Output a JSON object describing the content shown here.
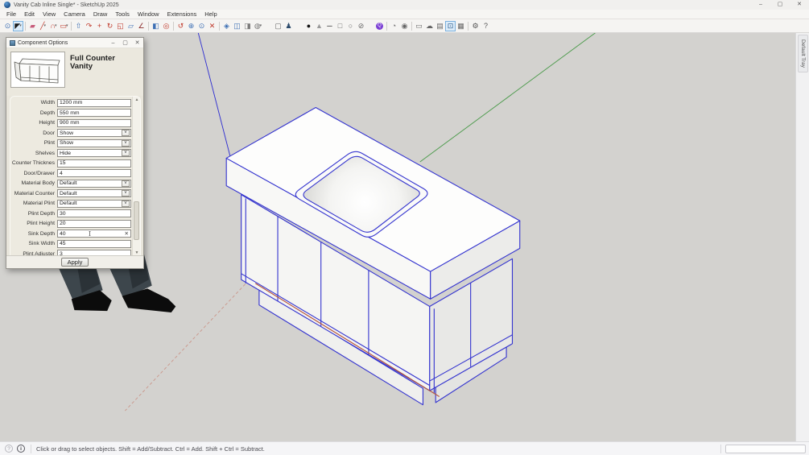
{
  "window": {
    "title": "Vanity Cab Inline Single* - SketchUp 2025"
  },
  "menu": {
    "items": [
      "File",
      "Edit",
      "View",
      "Camera",
      "Draw",
      "Tools",
      "Window",
      "Extensions",
      "Help"
    ]
  },
  "toolbar": {
    "items": [
      {
        "name": "search",
        "glyph": "⊙",
        "color": "#3d6fb4"
      },
      {
        "name": "select",
        "glyph": "◤",
        "color": "#1a1a1a",
        "active": true,
        "dd": true
      },
      {
        "sep": true
      },
      {
        "name": "eraser",
        "glyph": "▰",
        "color": "#c75b7a"
      },
      {
        "name": "line",
        "glyph": "╱",
        "color": "#c0392b",
        "dd": true
      },
      {
        "name": "arc",
        "glyph": "∩",
        "color": "#c0392b",
        "dd": true
      },
      {
        "name": "rectangle",
        "glyph": "▭",
        "color": "#c0392b",
        "dd": true
      },
      {
        "sep": true
      },
      {
        "name": "push-pull",
        "glyph": "⇧",
        "color": "#3d6fb4"
      },
      {
        "name": "follow-me",
        "glyph": "↷",
        "color": "#c0392b"
      },
      {
        "name": "move",
        "glyph": "+",
        "color": "#c0392b"
      },
      {
        "name": "rotate",
        "glyph": "↻",
        "color": "#c0392b"
      },
      {
        "name": "scale",
        "glyph": "◱",
        "color": "#c0392b"
      },
      {
        "name": "tape-measure",
        "glyph": "▱",
        "color": "#3d6fb4"
      },
      {
        "name": "axes",
        "glyph": "∠",
        "color": "#8a2a2a"
      },
      {
        "sep": true
      },
      {
        "name": "paint-bucket",
        "glyph": "◧",
        "color": "#3d6fb4"
      },
      {
        "name": "offset",
        "glyph": "◎",
        "color": "#c0392b"
      },
      {
        "sep": true
      },
      {
        "name": "orbit",
        "glyph": "↺",
        "color": "#c0392b"
      },
      {
        "name": "pan",
        "glyph": "⊕",
        "color": "#3d6fb4"
      },
      {
        "name": "zoom",
        "glyph": "⊙",
        "color": "#3d6fb4"
      },
      {
        "name": "zoom-extents",
        "glyph": "✕",
        "color": "#c0392b"
      },
      {
        "sep": true
      },
      {
        "name": "make-component",
        "glyph": "◈",
        "color": "#3d6fb4"
      },
      {
        "name": "component-browser",
        "glyph": "◫",
        "color": "#3d6fb4"
      },
      {
        "name": "share-model",
        "glyph": "◨",
        "color": "#7a7a7a"
      },
      {
        "name": "face-style",
        "glyph": "◍",
        "color": "#7a7a7a",
        "dd": true
      },
      {
        "gap": 12
      },
      {
        "name": "new-document",
        "glyph": "▢",
        "color": "#666666"
      },
      {
        "name": "add-person",
        "glyph": "♟",
        "color": "#2b4a6b"
      },
      {
        "gap": 12
      },
      {
        "name": "style-point",
        "glyph": "●",
        "color": "#111111"
      },
      {
        "name": "style-endpoint",
        "glyph": "▲",
        "color": "#999999"
      },
      {
        "name": "style-edge",
        "glyph": "─",
        "color": "#111111"
      },
      {
        "name": "style-face",
        "glyph": "□",
        "color": "#666666"
      },
      {
        "name": "style-circle",
        "glyph": "○",
        "color": "#666666"
      },
      {
        "name": "style-off",
        "glyph": "⊘",
        "color": "#666666"
      },
      {
        "gap": 10
      },
      {
        "name": "extension-avatar",
        "glyph": "Q",
        "color": "#ffffff",
        "avatar": true
      },
      {
        "sep": true
      },
      {
        "name": "interact",
        "glyph": "◔",
        "color": "#666666"
      },
      {
        "name": "dynamic-component",
        "glyph": "◉",
        "color": "#666666"
      },
      {
        "sep": true
      },
      {
        "name": "select-box",
        "glyph": "▭",
        "color": "#666666"
      },
      {
        "name": "warehouse-cloud",
        "glyph": "☁",
        "color": "#666666"
      },
      {
        "name": "camera-view",
        "glyph": "▤",
        "color": "#666666"
      },
      {
        "name": "component-options",
        "glyph": "⊡",
        "color": "#2a5a8a",
        "active": true
      },
      {
        "name": "component-attributes",
        "glyph": "▦",
        "color": "#666666"
      },
      {
        "sep": true
      },
      {
        "name": "extension-manager",
        "glyph": "⚙",
        "color": "#555555"
      },
      {
        "name": "help",
        "glyph": "?",
        "color": "#555555"
      }
    ]
  },
  "dialog": {
    "title": "Component Options",
    "heading": "Full Counter Vanity",
    "apply_label": "Apply",
    "form": {
      "rows": [
        {
          "label": "Width",
          "type": "text",
          "value": "1200 mm"
        },
        {
          "label": "Depth",
          "type": "text",
          "value": "550 mm"
        },
        {
          "label": "Height",
          "type": "text",
          "value": "900 mm"
        },
        {
          "label": "Door",
          "type": "select",
          "value": "Show"
        },
        {
          "label": "Plint",
          "type": "select",
          "value": "Show"
        },
        {
          "label": "Shelves",
          "type": "select",
          "value": "Hide"
        },
        {
          "label": "Counter Thicknes",
          "type": "text",
          "value": "15"
        },
        {
          "label": "Door/Drawer",
          "type": "text",
          "value": "4"
        },
        {
          "label": "Material Body",
          "type": "select",
          "value": "Default"
        },
        {
          "label": "Material Counter",
          "type": "select",
          "value": "Default"
        },
        {
          "label": "Material Plint",
          "type": "select",
          "value": "Default"
        },
        {
          "label": "Plint Depth",
          "type": "text",
          "value": "30"
        },
        {
          "label": "Plint Height",
          "type": "text",
          "value": "20"
        },
        {
          "label": "Sink Depth",
          "type": "text",
          "value": "40",
          "clearable": true,
          "cursor": true
        },
        {
          "label": "Sink Width",
          "type": "text",
          "value": "45"
        },
        {
          "label": "Plint Adjuster",
          "type": "text",
          "value": "3"
        }
      ]
    }
  },
  "statusbar": {
    "geolocation_icon": "?",
    "info_icon": "i",
    "hint": "Click or drag to select objects. Shift = Add/Subtract. Ctrl = Add. Shift + Ctrl = Subtract.",
    "measurements_value": ""
  },
  "tray": {
    "label": "Default Tray"
  },
  "icons": {
    "minimize": "–",
    "maximize": "▢",
    "close": "✕",
    "dialog_minimize": "–",
    "dialog_maximize": "▢",
    "dialog_close": "✕",
    "dropdown_small": "▾",
    "select_chevron": "˅",
    "clear": "✕",
    "scroll_up": "▲",
    "scroll_down": "▼"
  },
  "colors": {
    "selection_blue": "#3434cf",
    "axis_green": "#4a9a4a",
    "axis_red": "#b5543c",
    "axis_blue": "#2e2ed0",
    "viewport_bg": "#d3d2cf"
  }
}
